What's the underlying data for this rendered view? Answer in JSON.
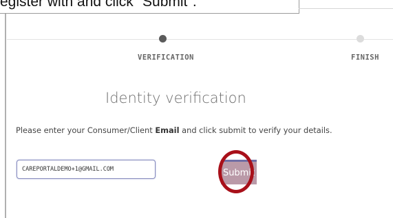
{
  "caption": {
    "text": "egister with and click \"Submit\"."
  },
  "steps": [
    {
      "label": "VERIFICATION",
      "state": "active"
    },
    {
      "label": "FINISH",
      "state": "inactive"
    }
  ],
  "form": {
    "heading": "Identity verification",
    "instruction_before": "Please enter your Consumer/Client ",
    "instruction_bold": "Email",
    "instruction_after": " and click submit to verify your details.",
    "email_value": "CAREPORTALDEMO+1@GMAIL.COM",
    "submit_label": "Submit"
  },
  "colors": {
    "active_dot": "#5b5b5b",
    "inactive_dot": "#dcdcdc",
    "submit_bg": "#ba9aa8",
    "highlight_ring": "#a8101a",
    "input_border": "#8489bd"
  }
}
